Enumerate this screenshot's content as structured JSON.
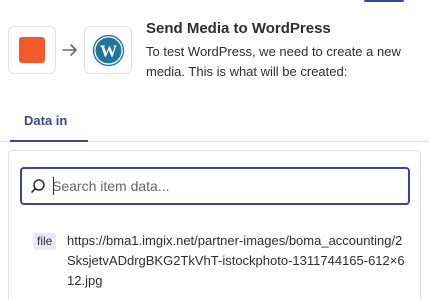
{
  "header": {
    "title": "Send Media to WordPress",
    "subtitle": "To test WordPress, we need to create a new media. This is what will be created:"
  },
  "apps": {
    "trigger_color": "#f15a2b",
    "action_icon": "wordpress-icon",
    "connector_icon": "arrow-right-icon"
  },
  "tabs": [
    {
      "label": "Data in",
      "active": true
    }
  ],
  "search": {
    "placeholder": "Search item data...",
    "value": ""
  },
  "items": [
    {
      "type": "file",
      "value": "https://bma1.imgix.net/partner-images/boma_accounting/2SksjetvADdrgBKG2TkVhT-istockphoto-1311744165-612×612.jpg"
    }
  ],
  "colors": {
    "accent": "#3d4592",
    "badge_bg": "#e7e9f7",
    "border": "#e3e1e6",
    "text": "#2d2e2e",
    "wordpress": "#21759b"
  }
}
